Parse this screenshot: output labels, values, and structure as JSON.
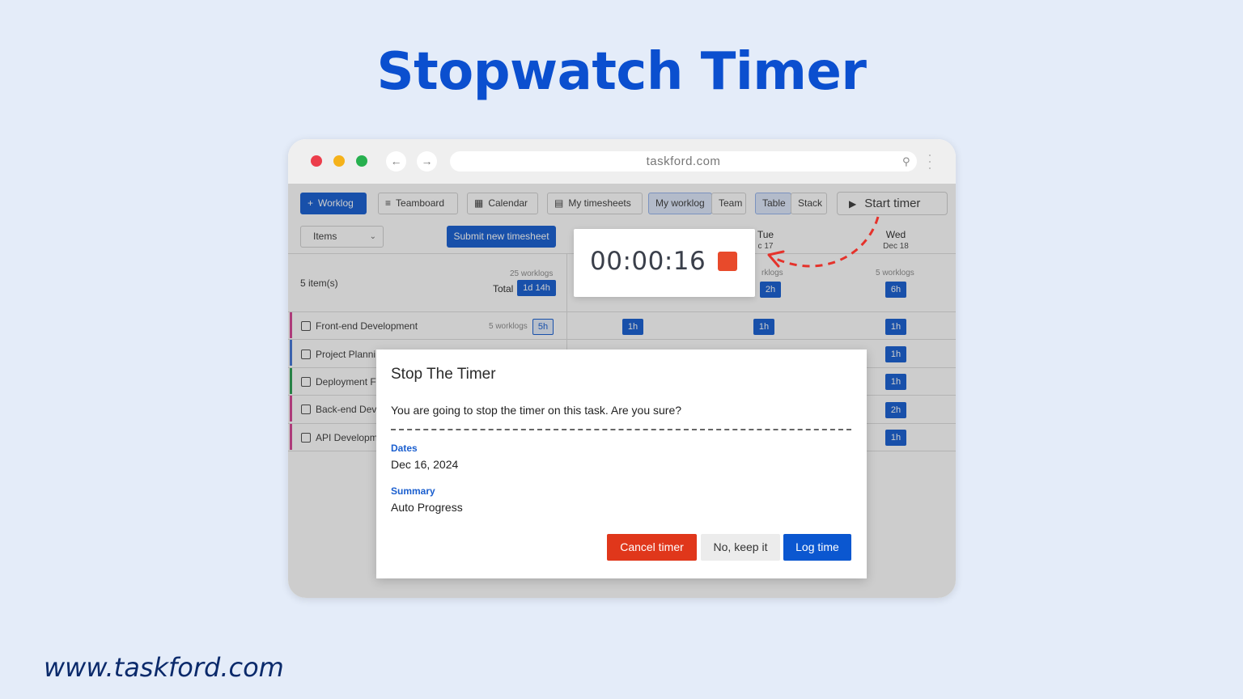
{
  "headline": "Stopwatch Timer",
  "footer_url": "www.taskford.com",
  "browser": {
    "url": "taskford.com"
  },
  "toolbar": {
    "worklog": "Worklog",
    "teamboard": "Teamboard",
    "calendar": "Calendar",
    "my_timesheets": "My timesheets",
    "my_worklog": "My worklog",
    "team": "Team",
    "table": "Table",
    "stack": "Stack",
    "start_timer": "Start timer"
  },
  "filters": {
    "items_select": "Items",
    "submit_timesheet": "Submit new timesheet"
  },
  "days": [
    {
      "day": "Tue",
      "date": "c 17"
    },
    {
      "day": "Wed",
      "date": "Dec 18"
    }
  ],
  "summary": {
    "count": "5 item(s)",
    "worklogs": "25 worklogs",
    "total_label": "Total",
    "total_value": "1d 14h",
    "tue_worklogs": "rklogs",
    "tue_value": "2h",
    "wed_worklogs": "5 worklogs",
    "wed_value": "6h"
  },
  "rows": [
    {
      "label": "Front-end Development",
      "worklogs": "5 worklogs",
      "total": "5h",
      "mon": "1h",
      "tue": "1h",
      "wed": "1h",
      "color": "#d63a8f"
    },
    {
      "label": "Project Planni",
      "wed": "1h",
      "color": "#3a6fd6"
    },
    {
      "label": "Deployment F",
      "wed": "1h",
      "color": "#1f9a4a"
    },
    {
      "label": "Back-end Dev",
      "wed": "2h",
      "color": "#d63a8f"
    },
    {
      "label": "API Developm",
      "wed": "1h",
      "color": "#d63a8f"
    }
  ],
  "timer": {
    "display": "00:00:16"
  },
  "dialog": {
    "title": "Stop The Timer",
    "message": "You are going to stop the timer on this task. Are you sure?",
    "dates_label": "Dates",
    "dates_value": "Dec 16, 2024",
    "summary_label": "Summary",
    "summary_value": "Auto Progress",
    "cancel_timer": "Cancel timer",
    "keep_it": "No, keep it",
    "log_time": "Log time"
  },
  "colors": {
    "brand": "#0b57d0",
    "danger": "#e0371b",
    "background": "#e4ecf9"
  }
}
